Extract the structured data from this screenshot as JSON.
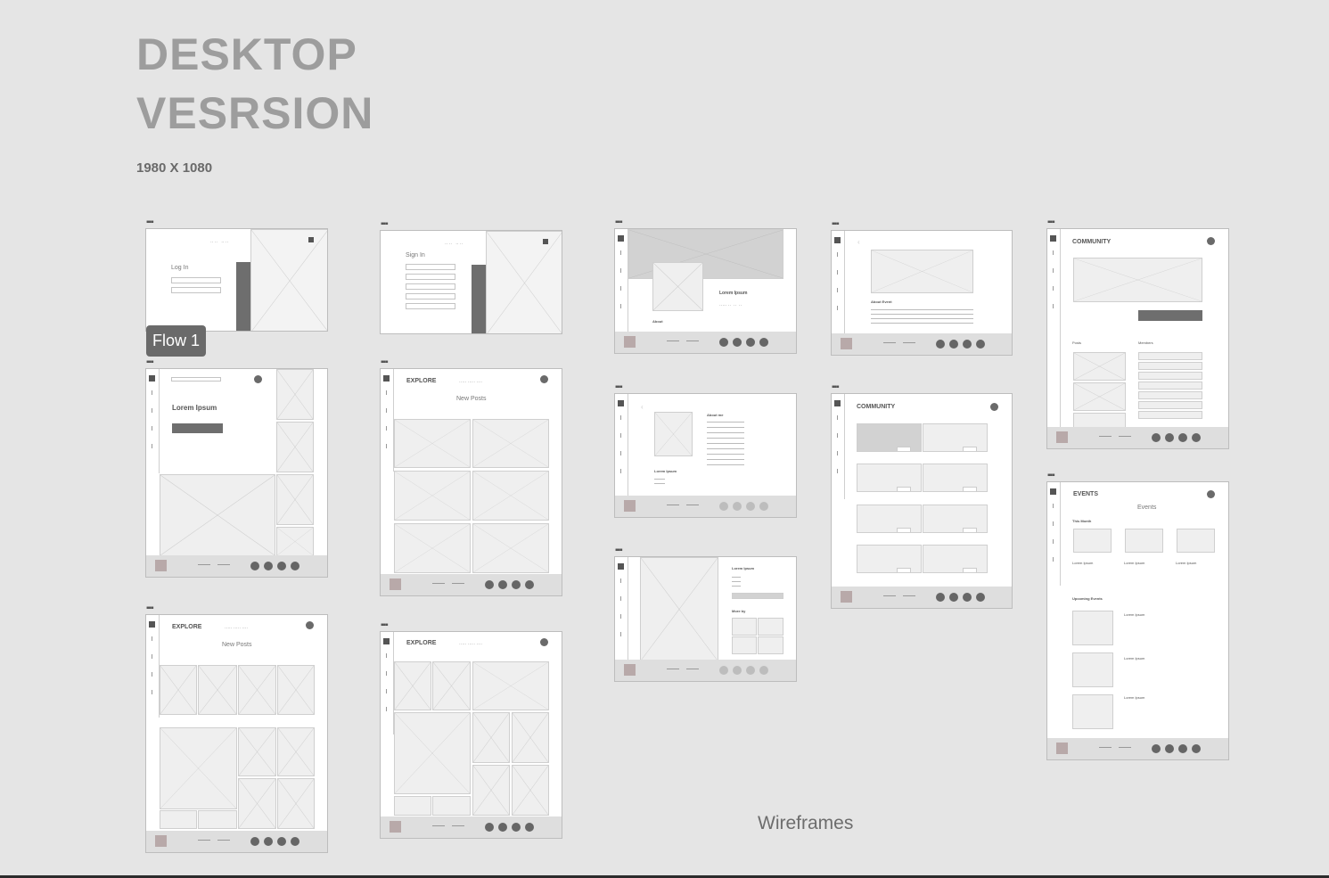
{
  "header": {
    "title_line1": "DESKTOP",
    "title_line2": "VESRSION",
    "subtitle": "1980 X 1080"
  },
  "badge": {
    "label": "Flow 1"
  },
  "caption": "Wireframes",
  "frame_dots": "▪▪▪",
  "frames": {
    "login": {
      "title": "Log In"
    },
    "signin": {
      "title": "Sign In"
    },
    "home": {
      "title": "Lorem Ipsum"
    },
    "explore1": {
      "title": "EXPLORE",
      "subtitle": "New Posts"
    },
    "explore2": {
      "title": "EXPLORE",
      "subtitle": "New Posts"
    },
    "explore3": {
      "title": "EXPLORE"
    },
    "profile": {
      "name": "Lorem Ipsum",
      "about": "About"
    },
    "about": {
      "heading": "About me",
      "name": "Lorem Ipsum"
    },
    "post": {
      "name": "Lorem Ipsum",
      "more_by": "More by"
    },
    "event_detail": {
      "heading": "About Event"
    },
    "community_list": {
      "title": "COMMUNITY"
    },
    "community": {
      "title": "COMMUNITY",
      "posts": "Posts",
      "members": "Members"
    },
    "events": {
      "title": "EVENTS",
      "subtitle": "Events",
      "this_month": "This Month",
      "upcoming": "Upcoming Events",
      "item": "Lorem Ipsum"
    }
  }
}
